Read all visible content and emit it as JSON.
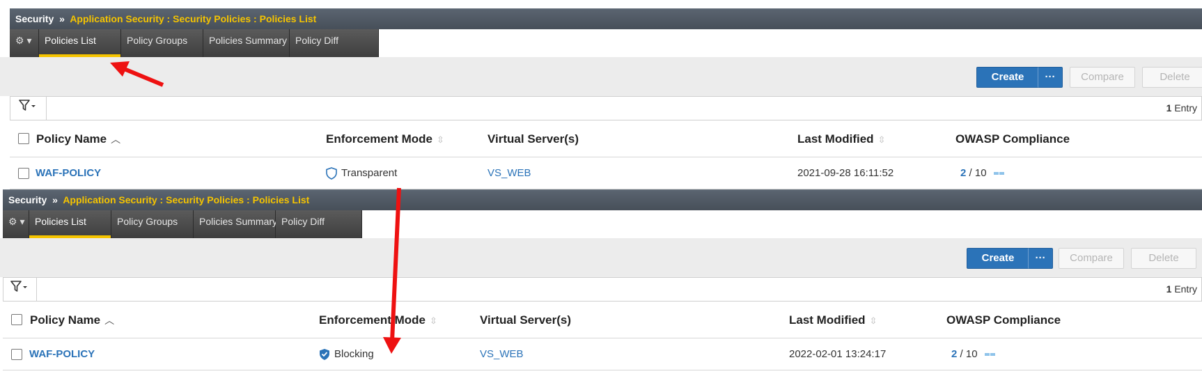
{
  "panels": [
    {
      "titlebar": {
        "section": "Security",
        "separator": "»",
        "breadcrumb": "Application Security : Security Policies : Policies List"
      },
      "tabs": {
        "gear": "⚙ ▾",
        "items": [
          "Policies List",
          "Policy Groups",
          "Policies Summary",
          "Policy Diff"
        ],
        "active": "Policies List"
      },
      "actions": {
        "create": "Create",
        "more": "···",
        "compare": "Compare",
        "delete": "Delete"
      },
      "filter": {
        "icon": "filter-icon",
        "entry_count": "1",
        "entry_label": "Entry"
      },
      "table": {
        "headers": {
          "policy_name": "Policy Name",
          "enforcement_mode": "Enforcement Mode",
          "virtual_servers": "Virtual Server(s)",
          "last_modified": "Last Modified",
          "owasp": "OWASP Compliance"
        },
        "rows": [
          {
            "policy_name": "WAF-POLICY",
            "enforcement_mode": "Transparent",
            "enforcement_icon": "shield-outline-icon",
            "virtual_servers": "VS_WEB",
            "last_modified": "2021-09-28 16:11:52",
            "owasp_score": "2",
            "owasp_total": "/ 10"
          }
        ]
      }
    },
    {
      "titlebar": {
        "section": "Security",
        "separator": "»",
        "breadcrumb": "Application Security : Security Policies : Policies List"
      },
      "tabs": {
        "gear": "⚙ ▾",
        "items": [
          "Policies List",
          "Policy Groups",
          "Policies Summary",
          "Policy Diff"
        ],
        "active": "Policies List"
      },
      "actions": {
        "create": "Create",
        "more": "···",
        "compare": "Compare",
        "delete": "Delete"
      },
      "filter": {
        "icon": "filter-icon",
        "entry_count": "1",
        "entry_label": "Entry"
      },
      "table": {
        "headers": {
          "policy_name": "Policy Name",
          "enforcement_mode": "Enforcement Mode",
          "virtual_servers": "Virtual Server(s)",
          "last_modified": "Last Modified",
          "owasp": "OWASP Compliance"
        },
        "rows": [
          {
            "policy_name": "WAF-POLICY",
            "enforcement_mode": "Blocking",
            "enforcement_icon": "shield-check-icon",
            "virtual_servers": "VS_WEB",
            "last_modified": "2022-02-01 13:24:17",
            "owasp_score": "2",
            "owasp_total": "/ 10"
          }
        ]
      }
    }
  ],
  "colors": {
    "accent_yellow": "#f5c400",
    "primary_blue": "#2b73b8",
    "annotation_red": "#ee1111",
    "titlebar": "#4f5862"
  }
}
